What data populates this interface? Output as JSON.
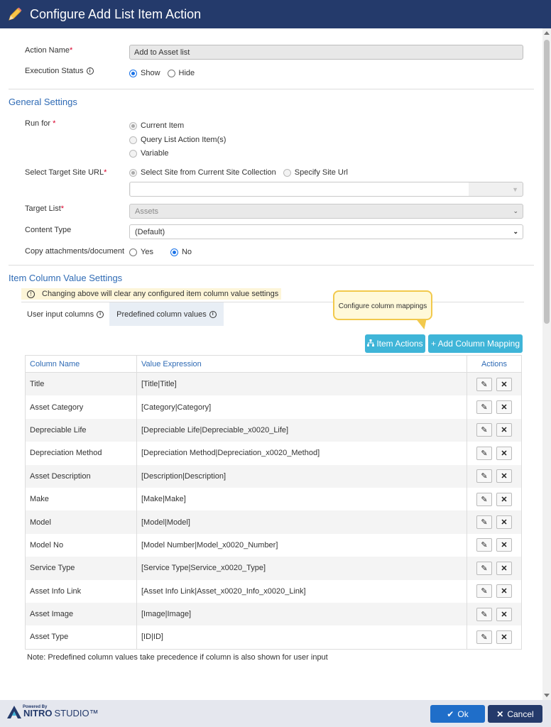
{
  "header": {
    "title": "Configure Add List Item Action"
  },
  "form": {
    "action_name_label": "Action Name",
    "action_name_value": "Add to Asset list",
    "execution_status_label": "Execution Status",
    "execution_options": [
      "Show",
      "Hide"
    ],
    "execution_selected": "Show"
  },
  "general": {
    "title": "General Settings",
    "run_for_label": "Run for",
    "run_for_options": [
      "Current Item",
      "Query List Action Item(s)",
      "Variable"
    ],
    "target_site_label": "Select Target Site URL",
    "target_site_options": [
      "Select Site from Current Site Collection",
      "Specify Site Url"
    ],
    "target_list_label": "Target List",
    "target_list_value": "Assets",
    "content_type_label": "Content Type",
    "content_type_value": "(Default)",
    "copy_label": "Copy attachments/document",
    "copy_options": [
      "Yes",
      "No"
    ],
    "copy_selected": "No"
  },
  "item_settings": {
    "title": "Item Column Value Settings",
    "warning": "Changing above will clear any configured item column value settings",
    "tabs": [
      "User input columns",
      "Predefined column values"
    ],
    "active_tab": "Predefined column values",
    "tooltip": "Configure column mappings",
    "item_actions_label": "Item Actions",
    "add_mapping_label": "+ Add Column Mapping",
    "columns": [
      "Column Name",
      "Value Expression",
      "Actions"
    ],
    "rows": [
      {
        "name": "Title",
        "value": "[Title|Title]"
      },
      {
        "name": "Asset Category",
        "value": "[Category|Category]"
      },
      {
        "name": "Depreciable Life",
        "value": "[Depreciable Life|Depreciable_x0020_Life]"
      },
      {
        "name": "Depreciation Method",
        "value": "[Depreciation Method|Depreciation_x0020_Method]"
      },
      {
        "name": "Asset Description",
        "value": "[Description|Description]"
      },
      {
        "name": "Make",
        "value": "[Make|Make]"
      },
      {
        "name": "Model",
        "value": "[Model|Model]"
      },
      {
        "name": "Model No",
        "value": "[Model Number|Model_x0020_Number]"
      },
      {
        "name": "Service Type",
        "value": "[Service Type|Service_x0020_Type]"
      },
      {
        "name": "Asset Info Link",
        "value": "[Asset Info Link|Asset_x0020_Info_x0020_Link]"
      },
      {
        "name": "Asset Image",
        "value": "[Image|Image]"
      },
      {
        "name": "Asset Type",
        "value": "[ID|ID]"
      }
    ],
    "note": "Note: Predefined column values take precedence if column is also shown for user input"
  },
  "footer": {
    "powered_by": "Powered By",
    "brand_nitro": "NITRO",
    "brand_studio": "STUDIO™",
    "ok_label": "Ok",
    "cancel_label": "Cancel"
  },
  "colors": {
    "header": "#243a6b",
    "accent": "#2f6bb5",
    "teal": "#3fb5d8",
    "ok": "#1f6ec9",
    "cancel": "#243a6b"
  }
}
